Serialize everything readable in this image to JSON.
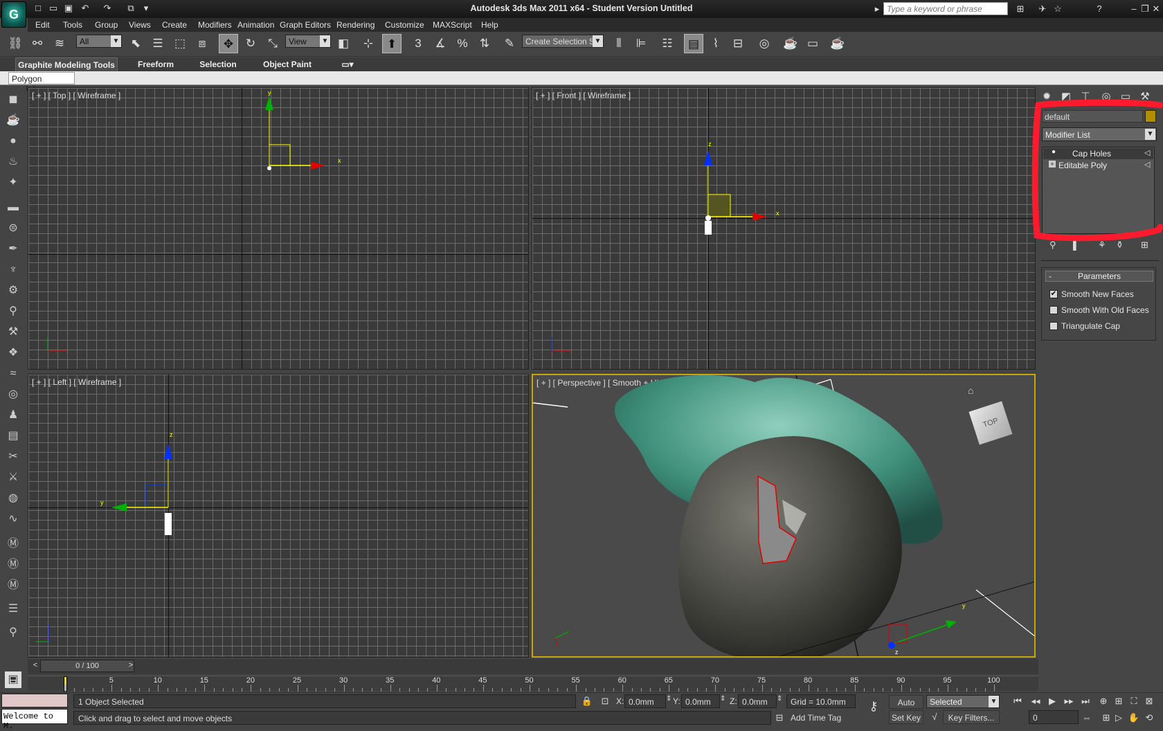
{
  "title": "Autodesk 3ds Max  2011 x64  - Student Version   Untitled",
  "search": {
    "placeholder": "Type a keyword or phrase"
  },
  "menu": [
    "Edit",
    "Tools",
    "Group",
    "Views",
    "Create",
    "Modifiers",
    "Animation",
    "Graph Editors",
    "Rendering",
    "Customize",
    "MAXScript",
    "Help"
  ],
  "toolbar": {
    "filter_value": "All",
    "ref_coord_value": "View",
    "snap_labels": [
      "3",
      "%"
    ],
    "named_selection": "Create Selection Se"
  },
  "ribbon": {
    "tabs": [
      "Graphite Modeling Tools",
      "Freeform",
      "Selection",
      "Object Paint"
    ],
    "sub_tab": "Polygon Modeling"
  },
  "viewports": {
    "top": "[ + ] [ Top ] [ Wireframe ]",
    "front": "[ + ] [ Front ] [ Wireframe ]",
    "left": "[ + ] [ Left ] [ Wireframe ]",
    "perspective": "[ + ] [ Perspective ] [ Smooth + Highlights ]",
    "viewcube_label": "TOP",
    "axis": {
      "x": "x",
      "y": "y",
      "z": "z"
    }
  },
  "command_panel": {
    "object_name": "default",
    "object_color": "#b38f00",
    "modifier_list": "Modifier List",
    "stack": [
      "Cap Holes",
      "Editable Poly"
    ],
    "rollout_title": "Parameters",
    "collapse": "-",
    "params": [
      {
        "label": "Smooth New Faces",
        "checked": true
      },
      {
        "label": "Smooth With Old Faces",
        "checked": false
      },
      {
        "label": "Triangulate Cap",
        "checked": false
      }
    ]
  },
  "timeline": {
    "slider": "0 / 100",
    "ticks": [
      "5",
      "10",
      "15",
      "20",
      "25",
      "30",
      "35",
      "40",
      "45",
      "50",
      "55",
      "60",
      "65",
      "70",
      "75",
      "80",
      "85",
      "90",
      "95",
      "100"
    ]
  },
  "status": {
    "maxscript": "Welcome to M.",
    "selected": "1 Object Selected",
    "prompt": "Click and drag to select and move objects",
    "x_label": "X:",
    "x": "0.0mm",
    "y_label": "Y:",
    "y": "0.0mm",
    "z_label": "Z:",
    "z": "0.0mm",
    "grid": "Grid = 10.0mm",
    "add_time_tag": "Add Time Tag",
    "auto_key": "Auto Key",
    "set_key": "Set Key",
    "key_mode": "Selected",
    "key_filters": "Key Filters...",
    "frame": "0"
  },
  "colors": {
    "highlight": "#ff1a2e",
    "viewport_border_active": "#c8a800",
    "gizmo_x": "#e00000",
    "gizmo_y": "#00b000",
    "gizmo_z": "#0030ff"
  }
}
